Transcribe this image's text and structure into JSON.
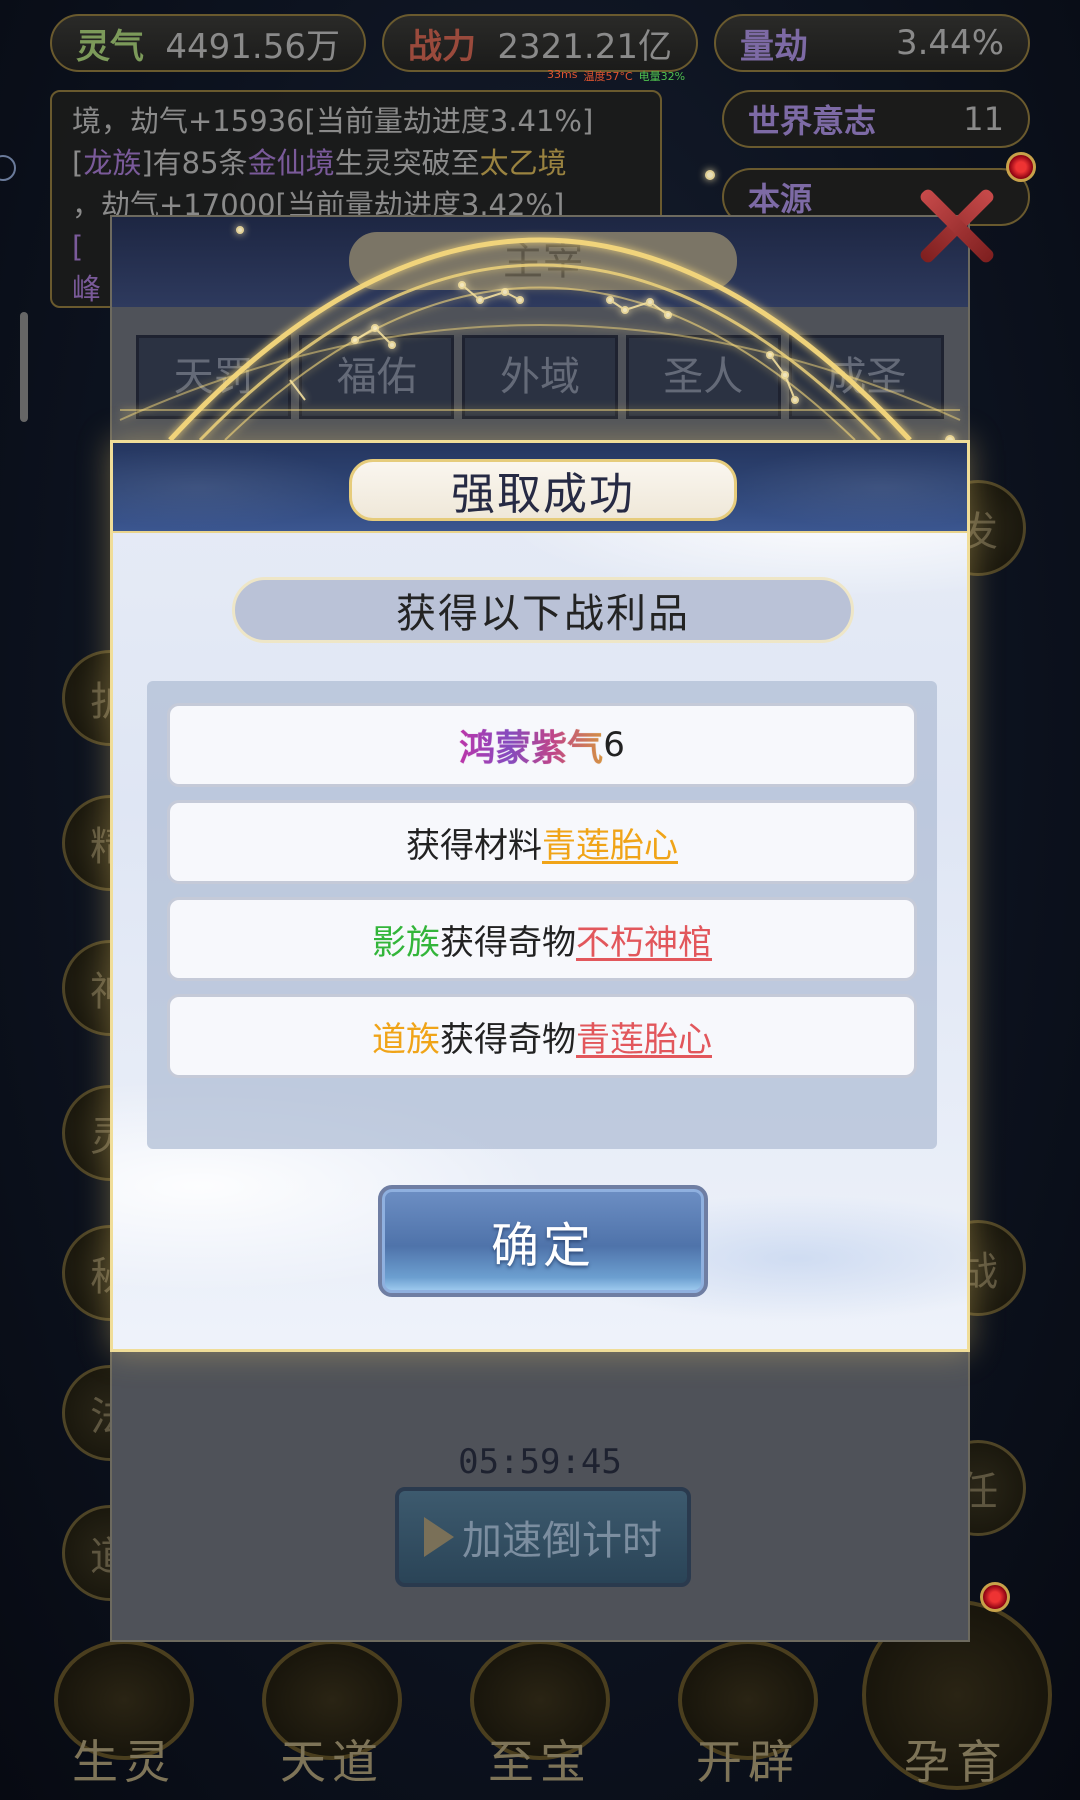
{
  "status_bar": {
    "lingqi_label": "灵气",
    "lingqi_value": "4491.56万",
    "zhanli_label": "战力",
    "zhanli_value": "2321.21亿",
    "liangjie_label": "量劫",
    "liangjie_value": "3.44%"
  },
  "net_stats": {
    "ping": "33ms",
    "temperature": "温度57°C",
    "battery": "电量32%"
  },
  "log": {
    "line1": "境，劫气+15936[当前量劫进度3.41%]",
    "line2_prefix": "[",
    "line2_clan": "龙族",
    "line2_mid": "]有85条",
    "line2_realm_from": "金仙境",
    "line2_mid2": "生灵突破至",
    "line2_realm_to": "太乙境",
    "line3": "，劫气+17000[当前量劫进度3.42%]",
    "line4": "[",
    "line5": "峰"
  },
  "side_panel": {
    "world_will_label": "世界意志",
    "world_will_value": "11",
    "origin_label": "本源"
  },
  "side_icons": {
    "right_1": "发",
    "right_2": "战",
    "right_3": "任",
    "left_1": "护",
    "left_2": "精",
    "left_3": "神",
    "left_4": "灵",
    "left_5": "秘",
    "left_6": "法",
    "left_7": "道"
  },
  "bottom_nav": [
    {
      "label": "生灵"
    },
    {
      "label": "天道"
    },
    {
      "label": "至宝"
    },
    {
      "label": "开辟"
    },
    {
      "label": "孕育"
    }
  ],
  "underlying_panel": {
    "title": "主宰",
    "tabs": [
      "天罚",
      "福佑",
      "外域",
      "圣人",
      "成圣"
    ],
    "timer": "05:59:45",
    "speed_button": "加速倒计时"
  },
  "modal": {
    "title": "强取成功",
    "loot_heading": "获得以下战利品",
    "rows": [
      {
        "item": "鸿蒙紫气",
        "count": "6"
      },
      {
        "prefix": "获得材料",
        "item": "青莲胎心"
      },
      {
        "clan": "影族",
        "middle": "获得奇物",
        "item": "不朽神棺"
      },
      {
        "clan": "道族",
        "middle": "获得奇物",
        "item": "青莲胎心"
      }
    ],
    "confirm_label": "确定"
  },
  "colors": {
    "clan_shadow": "#33b53a",
    "clan_dao": "#f0a418",
    "material_item": "#f0a418",
    "artifact_item": "#e2575c",
    "modal_header": "#2f4677",
    "gold_border": "#f0dd98"
  }
}
